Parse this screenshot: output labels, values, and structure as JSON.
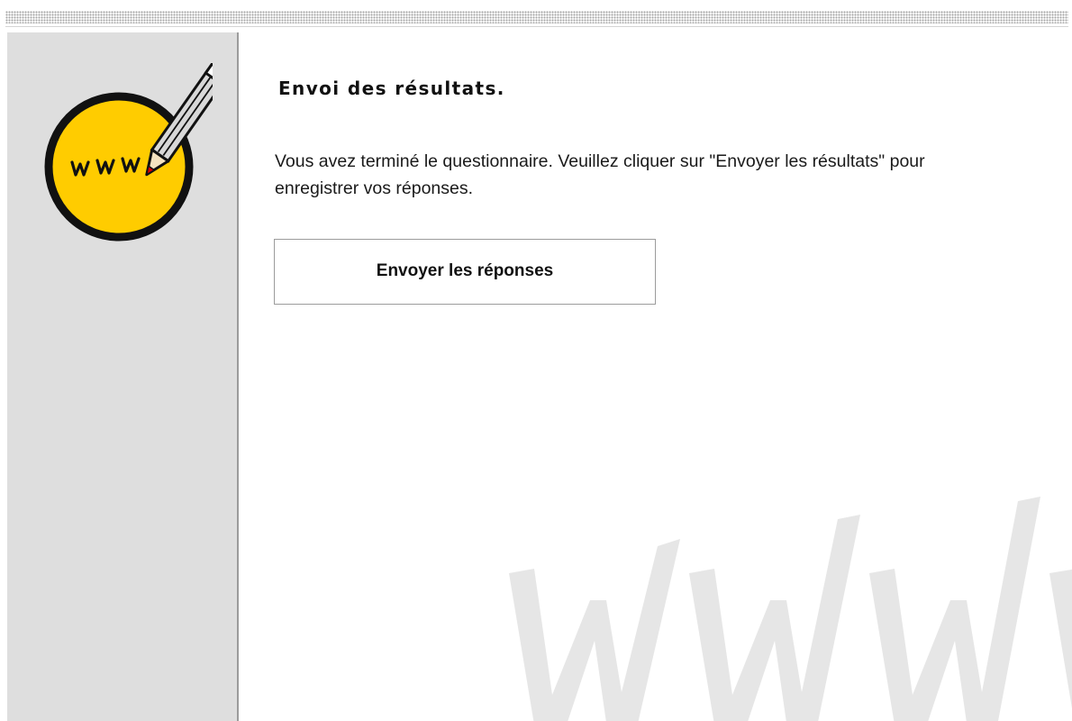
{
  "page": {
    "title": "Envoi des résultats.",
    "message": "Vous avez terminé le questionnaire. Veuillez cliquer sur \"Envoyer les résultats\" pour enregistrer vos réponses.",
    "submit_label": "Envoyer les réponses"
  },
  "logo": {
    "text": "WWW",
    "icon": "www-pencil-logo-icon",
    "colors": {
      "circle_fill": "#FFCC00",
      "circle_stroke": "#111111",
      "pencil_tip": "#D80000"
    }
  },
  "watermark": {
    "icon": "www-watermark-icon",
    "color": "#E6E6E6"
  },
  "colors": {
    "sidebar": "#DEDEDE",
    "sidebar_border": "#9C9C9C",
    "button_border": "#9C9C9C"
  }
}
